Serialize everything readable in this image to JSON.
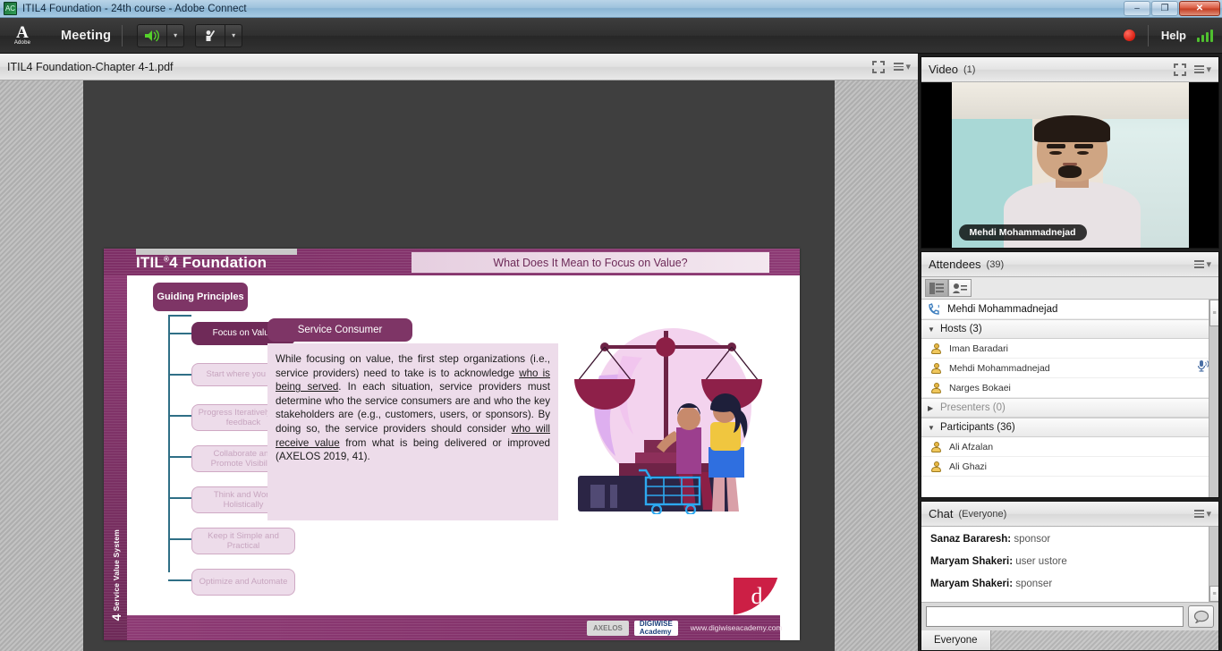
{
  "window": {
    "title": "ITIL4 Foundation - 24th course - Adobe Connect",
    "app_icon": "connect-app-icon",
    "minimize_label": "–",
    "restore_label": "❐",
    "close_label": "✕"
  },
  "appbar": {
    "brand": "A",
    "brand_word": "Adobe",
    "meeting_menu": "Meeting",
    "speaker_icon": "speaker-icon",
    "speaker_caret": "▾",
    "hand_icon": "raise-hand-icon",
    "hand_caret": "▾",
    "recording_icon": "recording-dot-icon",
    "help_label": "Help",
    "connection_icon": "connection-strength-icon"
  },
  "share_pod": {
    "title": "ITIL4 Foundation-Chapter 4-1.pdf",
    "fullscreen_icon": "fullscreen-icon",
    "menu_icon": "pod-menu-icon"
  },
  "slide": {
    "brand": "ITIL",
    "brand_sup": "®",
    "brand_rest": "4 Foundation",
    "title": "What Does It Mean to Focus on Value?",
    "vertical_number": "4",
    "vertical_label": "Service Value System",
    "guiding_principles": "Guiding Principles",
    "service_consumer_tab": "Service Consumer",
    "principles": [
      "Focus on Value",
      "Start where you are",
      "Progress Iteratively with feedback",
      "Collaborate and Promote Visibility",
      "Think and Work Holistically",
      "Keep it Simple and Practical",
      "Optimize and Automate"
    ],
    "body_parts": {
      "p1": "While focusing on value, the first step organizations (i.e., service providers) need to take is to acknowledge ",
      "u1": "who is being served",
      "p2": ". In each situation, service providers must determine who the service consumers are and who the key stakeholders are (e.g., customers, users, or sponsors). By doing so, the service providers should consider ",
      "u2": "who will receive value",
      "p3": " from what is being delivered or improved (AXELOS 2019, 41)."
    },
    "illustration_name": "scales-of-value-illustration",
    "footer": {
      "logo_axelos": "AXELOS",
      "logo_academy": "DIGIWISE Academy",
      "url": "www.digiwiseacademy.com",
      "corner_logo": "d"
    }
  },
  "video_pod": {
    "title": "Video",
    "count": "(1)",
    "fullscreen_icon": "fullscreen-icon",
    "menu_icon": "pod-menu-icon",
    "participant_name": "Mehdi Mohammadnejad"
  },
  "attendees_pod": {
    "title": "Attendees",
    "count": "(39)",
    "menu_icon": "pod-menu-icon",
    "view_list_icon": "list-view-icon",
    "view_card_icon": "card-view-icon",
    "me": {
      "name": "Mehdi Mohammadnejad",
      "icon": "phone-icon"
    },
    "groups": [
      {
        "label": "Hosts (3)",
        "caret": "▼",
        "expanded": true,
        "members": [
          {
            "name": "Iman Baradari",
            "icon": "user-icon",
            "mic": ""
          },
          {
            "name": "Mehdi Mohammadnejad",
            "icon": "user-icon",
            "mic": "microphone-active-icon"
          },
          {
            "name": "Narges Bokaei",
            "icon": "user-icon",
            "mic": ""
          }
        ]
      },
      {
        "label": "Presenters (0)",
        "caret": "▶",
        "expanded": false,
        "members": []
      },
      {
        "label": "Participants (36)",
        "caret": "▼",
        "expanded": true,
        "members": [
          {
            "name": "Ali Afzalan",
            "icon": "user-icon",
            "mic": ""
          },
          {
            "name": "Ali Ghazi",
            "icon": "user-with-note-icon",
            "mic": ""
          }
        ]
      }
    ]
  },
  "chat_pod": {
    "title": "Chat",
    "scope": "(Everyone)",
    "menu_icon": "pod-menu-icon",
    "messages": [
      {
        "sender": "Sanaz Bararesh:",
        "text": " sponsor"
      },
      {
        "sender": "Maryam Shakeri:",
        "text": " user ustore"
      },
      {
        "sender": "Maryam Shakeri:",
        "text": " sponser"
      }
    ],
    "input_value": "",
    "input_placeholder": "",
    "send_icon": "chat-bubble-icon",
    "tab_label": "Everyone"
  },
  "colors": {
    "brand_purple": "#7e3566",
    "slide_light": "#eddcea",
    "accent_red": "#cc1f45",
    "recording": "#d81f12",
    "signal_green": "#4fbf2f"
  }
}
